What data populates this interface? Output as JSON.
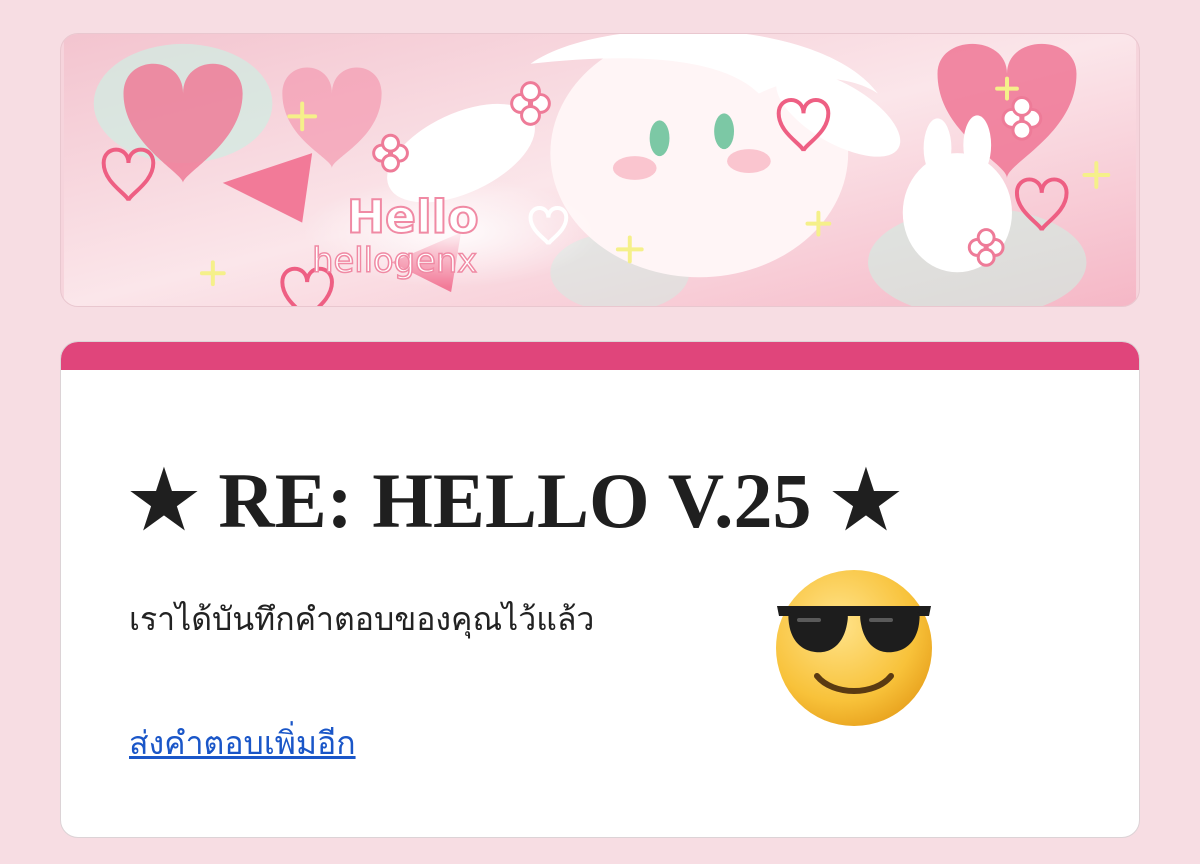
{
  "banner": {
    "logo_line1": "Hello",
    "logo_line2": "hellogenx"
  },
  "form": {
    "title": "★ RE: HELLO V.25 ★",
    "confirmation_message": "เราได้บันทึกคำตอบของคุณไว้แล้ว",
    "submit_another_link": "ส่งคำตอบเพิ่มอีก",
    "emoji": "smiling-face-with-sunglasses"
  },
  "colors": {
    "page_background": "#f7dde3",
    "card_accent": "#e0457b",
    "link": "#1a56c8",
    "title_text": "#1f1f1f"
  }
}
